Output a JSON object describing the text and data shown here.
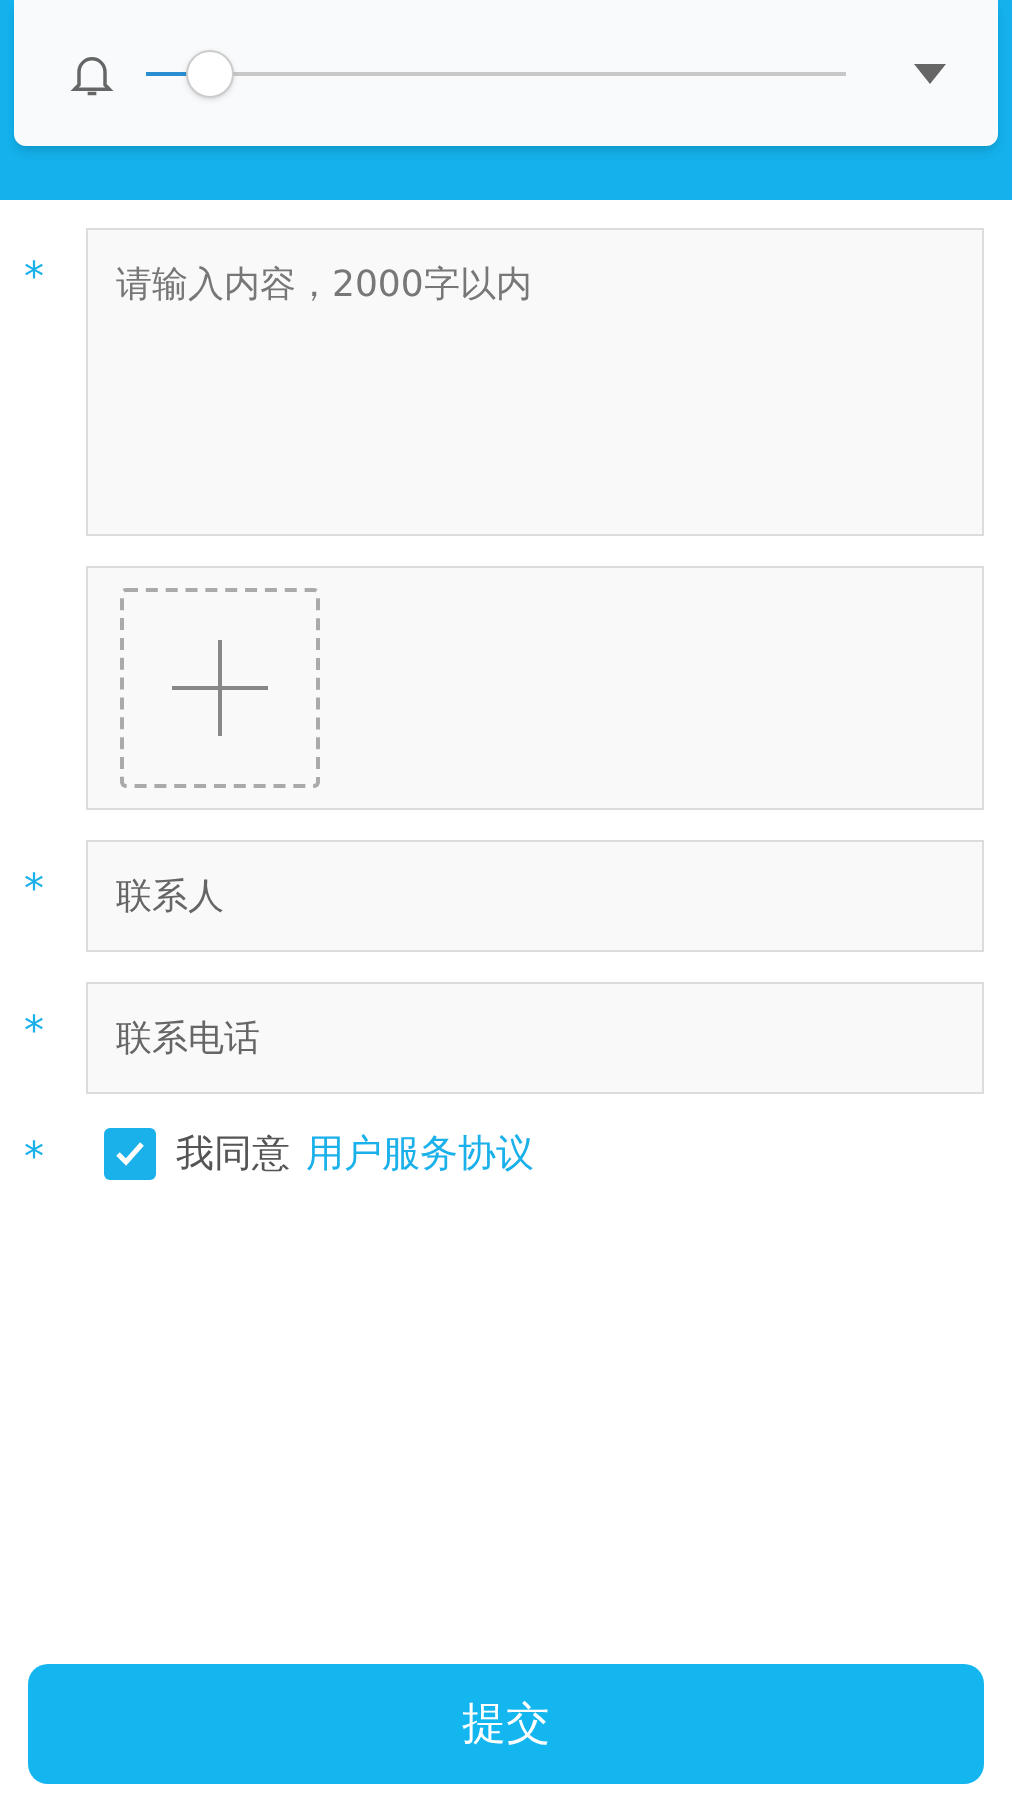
{
  "volume_panel": {
    "level": 0.09
  },
  "form": {
    "content": {
      "required_mark": "*",
      "placeholder": "请输入内容，2000字以内"
    },
    "fields": [
      {
        "required_mark": "*",
        "placeholder": "联系人"
      },
      {
        "required_mark": "*",
        "placeholder": "联系电话"
      }
    ],
    "agreement": {
      "required_mark": "*",
      "checked": true,
      "label": "我同意",
      "link": "用户服务协议"
    }
  },
  "submit": "提交"
}
